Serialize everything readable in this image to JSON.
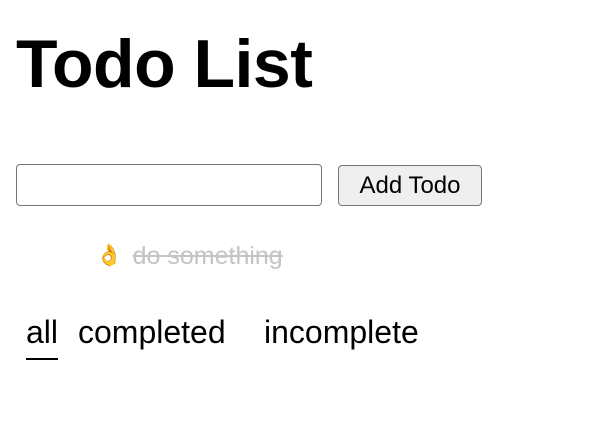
{
  "app": {
    "title": "Todo List"
  },
  "form": {
    "input_value": "",
    "input_placeholder": "",
    "add_button_label": "Add Todo"
  },
  "todos": [
    {
      "status_icon": "ok-hand-icon",
      "status_glyph": "👌",
      "text": "do something",
      "completed": true
    }
  ],
  "filters": {
    "items": [
      {
        "label": "all",
        "active": true
      },
      {
        "label": "completed",
        "active": false
      },
      {
        "label": "incomplete",
        "active": false
      }
    ]
  },
  "colors": {
    "completed_text": "#c4c4c4",
    "button_background": "#efefef",
    "border": "#767676"
  }
}
